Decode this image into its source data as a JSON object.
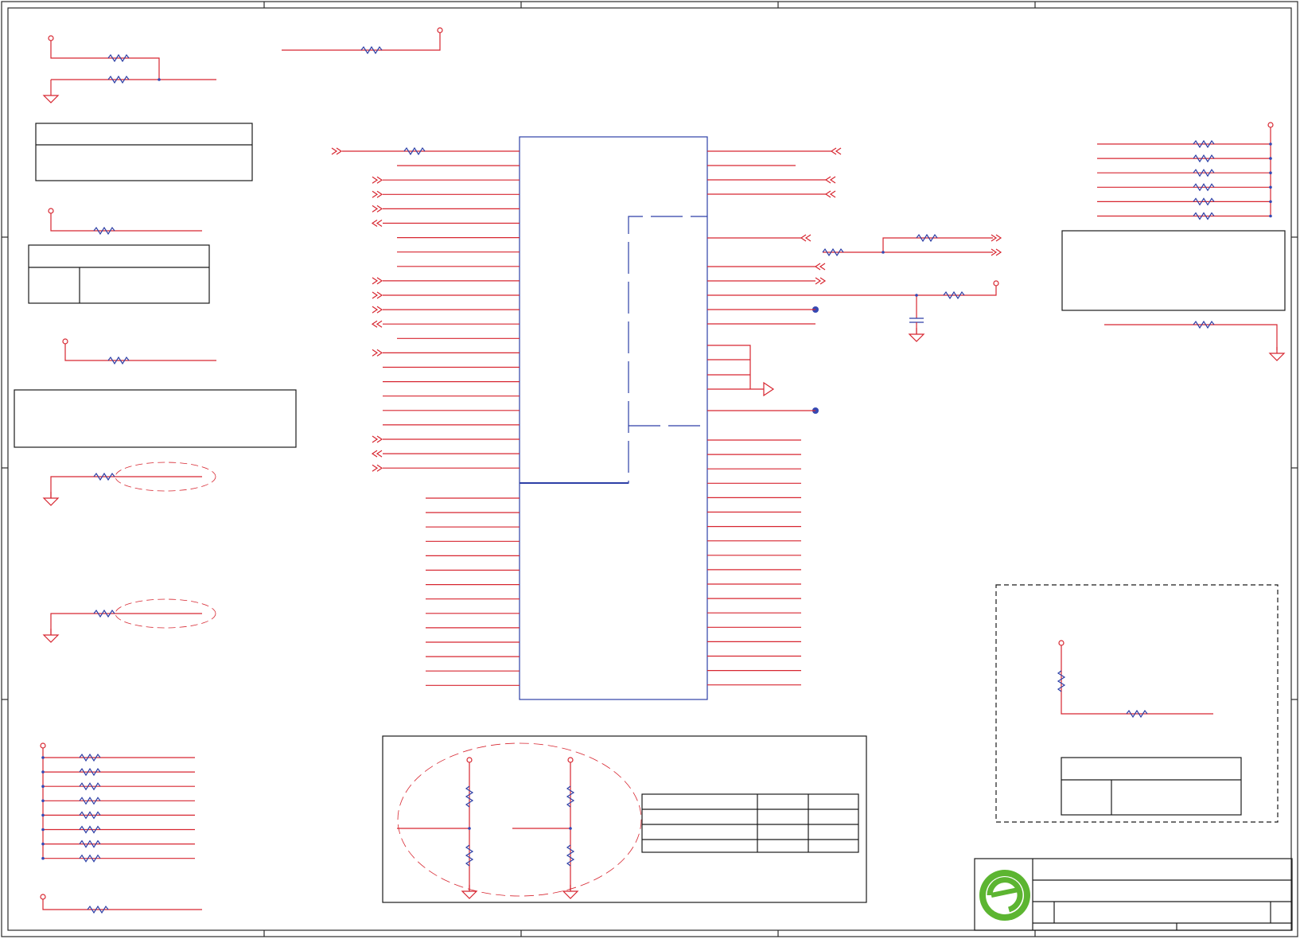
{
  "sheet": {
    "width_label": "",
    "colors": {
      "border": "#2b2b2b",
      "wire": "#d72630",
      "component": "#2d3fa6",
      "box": "#1a1a1a",
      "junction": "#3548b3",
      "logo_green": "#5cb531"
    },
    "net_labels": [],
    "title_block": {
      "company": "",
      "title": "",
      "size": "",
      "document_number": "",
      "revision": "",
      "date": "",
      "sheet_of": ""
    },
    "icons": [
      "company-logo-icon",
      "ground-icon",
      "power-port-icon",
      "offpage-connector-icon",
      "resistor-icon",
      "capacitor-icon"
    ]
  }
}
